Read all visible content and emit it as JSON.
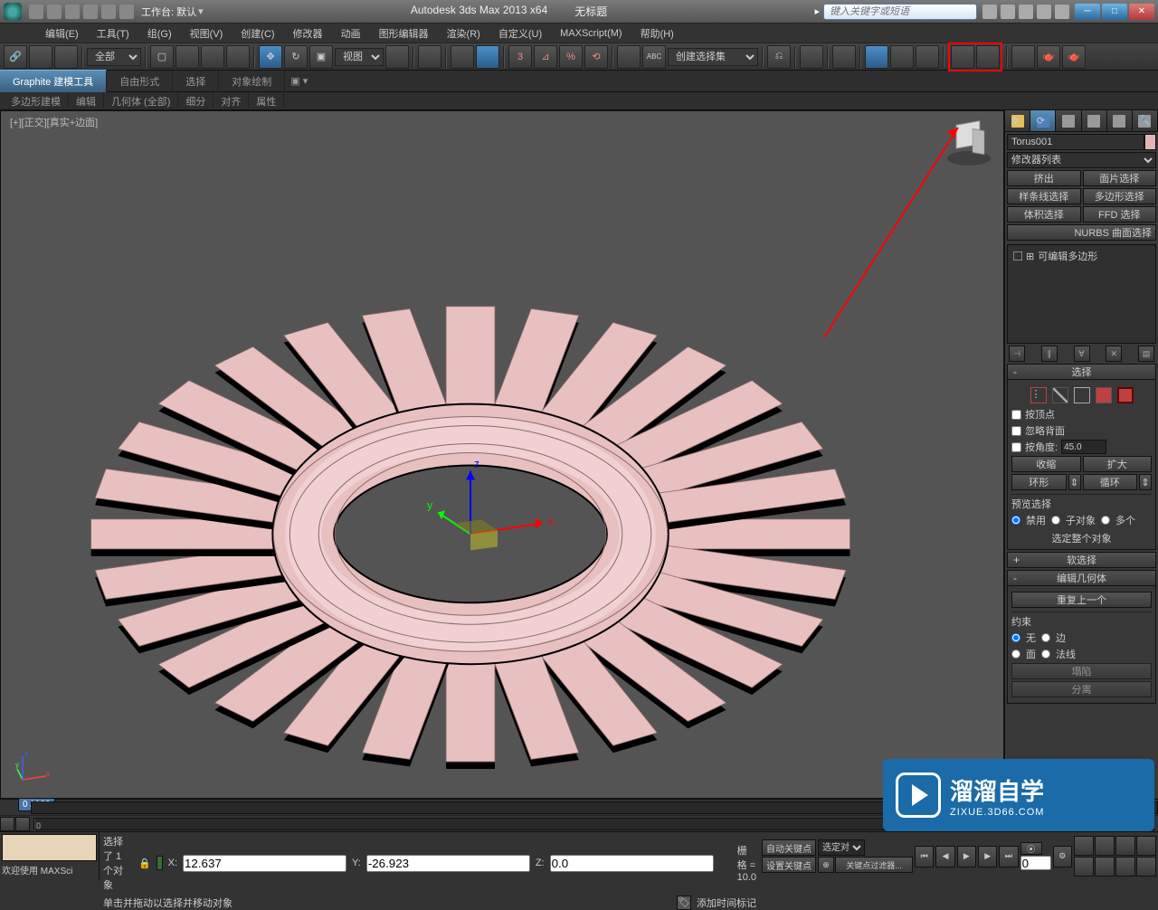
{
  "titlebar": {
    "workspace_label": "工作台: 默认",
    "app_title": "Autodesk 3ds Max  2013 x64",
    "doc_title": "无标题",
    "search_placeholder": "键入关键字或短语"
  },
  "menubar": {
    "items": [
      "编辑(E)",
      "工具(T)",
      "组(G)",
      "视图(V)",
      "创建(C)",
      "修改器",
      "动画",
      "图形编辑器",
      "渲染(R)",
      "自定义(U)",
      "MAXScript(M)",
      "帮助(H)"
    ]
  },
  "toolbar": {
    "filter_dd": "全部",
    "view_dd": "视图",
    "selset_dd": "创建选择集"
  },
  "ribbon": {
    "tabs": [
      "Graphite 建模工具",
      "自由形式",
      "选择",
      "对象绘制"
    ],
    "subtabs": [
      "多边形建模",
      "编辑",
      "几何体 (全部)",
      "细分",
      "对齐",
      "属性"
    ]
  },
  "viewport": {
    "label": "[+][正交][真实+边面]"
  },
  "cmd_panel": {
    "name": "Torus001",
    "mod_list_label": "修改器列表",
    "mod_buttons": [
      "挤出",
      "面片选择",
      "样条线选择",
      "多边形选择",
      "体积选择",
      "FFD 选择"
    ],
    "nurbs_btn": "NURBS 曲面选择",
    "stack_item": "可编辑多边形",
    "rollouts": {
      "selection": {
        "title": "选择",
        "by_vertex": "按顶点",
        "ignore_backface": "忽略背面",
        "by_angle": "按角度:",
        "angle_value": "45.0",
        "shrink": "收缩",
        "grow": "扩大",
        "ring": "环形",
        "loop": "循环",
        "preview_label": "预览选择",
        "disable": "禁用",
        "subobj": "子对象",
        "multi": "多个",
        "whole": "选定整个对象"
      },
      "soft": {
        "title": "软选择"
      },
      "editgeo": {
        "title": "编辑几何体",
        "repeat": "重复上一个",
        "constrain": "约束",
        "none": "无",
        "edge": "边",
        "face": "面",
        "normal": "法线",
        "collapse": "塌陷",
        "detach": "分离"
      }
    }
  },
  "timeline": {
    "frame": "0 / 100"
  },
  "status": {
    "welcome": "欢迎使用 MAXSci",
    "selected": "选择了 1 个对象",
    "prompt": "单击并拖动以选择并移动对象",
    "x": "12.637",
    "y": "-26.923",
    "z": "0.0",
    "grid": "栅格 = 10.0",
    "add_marker": "添加时间标记",
    "autokey": "自动关键点",
    "setkey": "设置关键点",
    "selset": "选定对",
    "keyfilter": "关键点过滤器..."
  },
  "watermark": {
    "brand": "溜溜自学",
    "url": "ZIXUE.3D66.COM"
  }
}
